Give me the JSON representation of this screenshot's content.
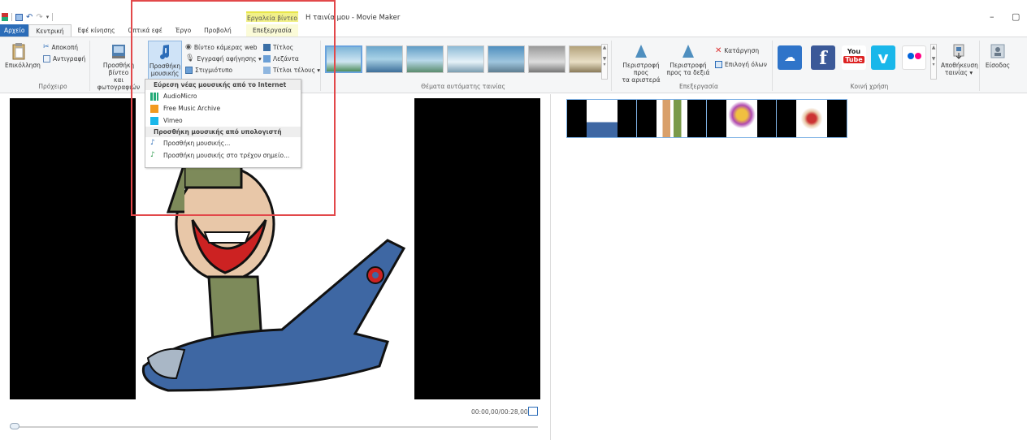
{
  "window": {
    "title": "Η ταινία μου - Movie Maker",
    "minimize": "–",
    "restore": "▢"
  },
  "contextual": {
    "group_label": "Εργαλεία βίντεο",
    "tab": "Επεξεργασία"
  },
  "tabs": [
    "Αρχείο",
    "Κεντρική",
    "Εφέ κίνησης",
    "Οπτικά εφέ",
    "Έργο",
    "Προβολή"
  ],
  "ribbon": {
    "clipboard": {
      "paste": "Επικόλληση",
      "cut": "Αποκοπή",
      "copy": "Αντιγραφή",
      "label": "Πρόχειρο"
    },
    "add": {
      "add_video_line1": "Προσθήκη βίντεο",
      "add_video_line2": "και φωτογραφιών",
      "add_music_line1": "Προσθήκη",
      "add_music_line2": "μουσικής ▾",
      "webcam": "Βίντεο κάμερας web",
      "narration": "Εγγραφή αφήγησης ▾",
      "snapshot": "Στιγμιότυπο",
      "title": "Τίτλος",
      "caption": "Λεζάντα",
      "credits": "Τίτλοι τέλους ▾"
    },
    "themes": {
      "label": "Θέματα αυτόματης ταινίας"
    },
    "editing": {
      "rotate_left_1": "Περιστροφή προς",
      "rotate_left_2": "τα αριστερά",
      "rotate_right_1": "Περιστροφή",
      "rotate_right_2": "προς τα δεξιά",
      "remove": "Κατάργηση",
      "select_all": "Επιλογή όλων",
      "label": "Επεξεργασία"
    },
    "share": {
      "label": "Κοινή χρήση",
      "youtube_top": "You",
      "youtube_bottom": "Tube"
    },
    "save_movie_1": "Αποθήκευση",
    "save_movie_2": "ταινίας ▾",
    "signin": "Είσοδος"
  },
  "music_menu": {
    "internet_header": "Εύρεση νέας μουσικής από το Internet",
    "internet_items": [
      "AudioMicro",
      "Free Music Archive",
      "Vimeo"
    ],
    "pc_header": "Προσθήκη μουσικής από υπολογιστή",
    "pc_items": [
      "Προσθήκη μουσικής...",
      "Προσθήκη μουσικής στο τρέχον σημείο..."
    ]
  },
  "player": {
    "timecode": "00:00,00/00:28,00"
  },
  "colors": {
    "accent": "#2b6cb8",
    "highlight": "#e2484a",
    "contextual": "#f1f08a"
  }
}
